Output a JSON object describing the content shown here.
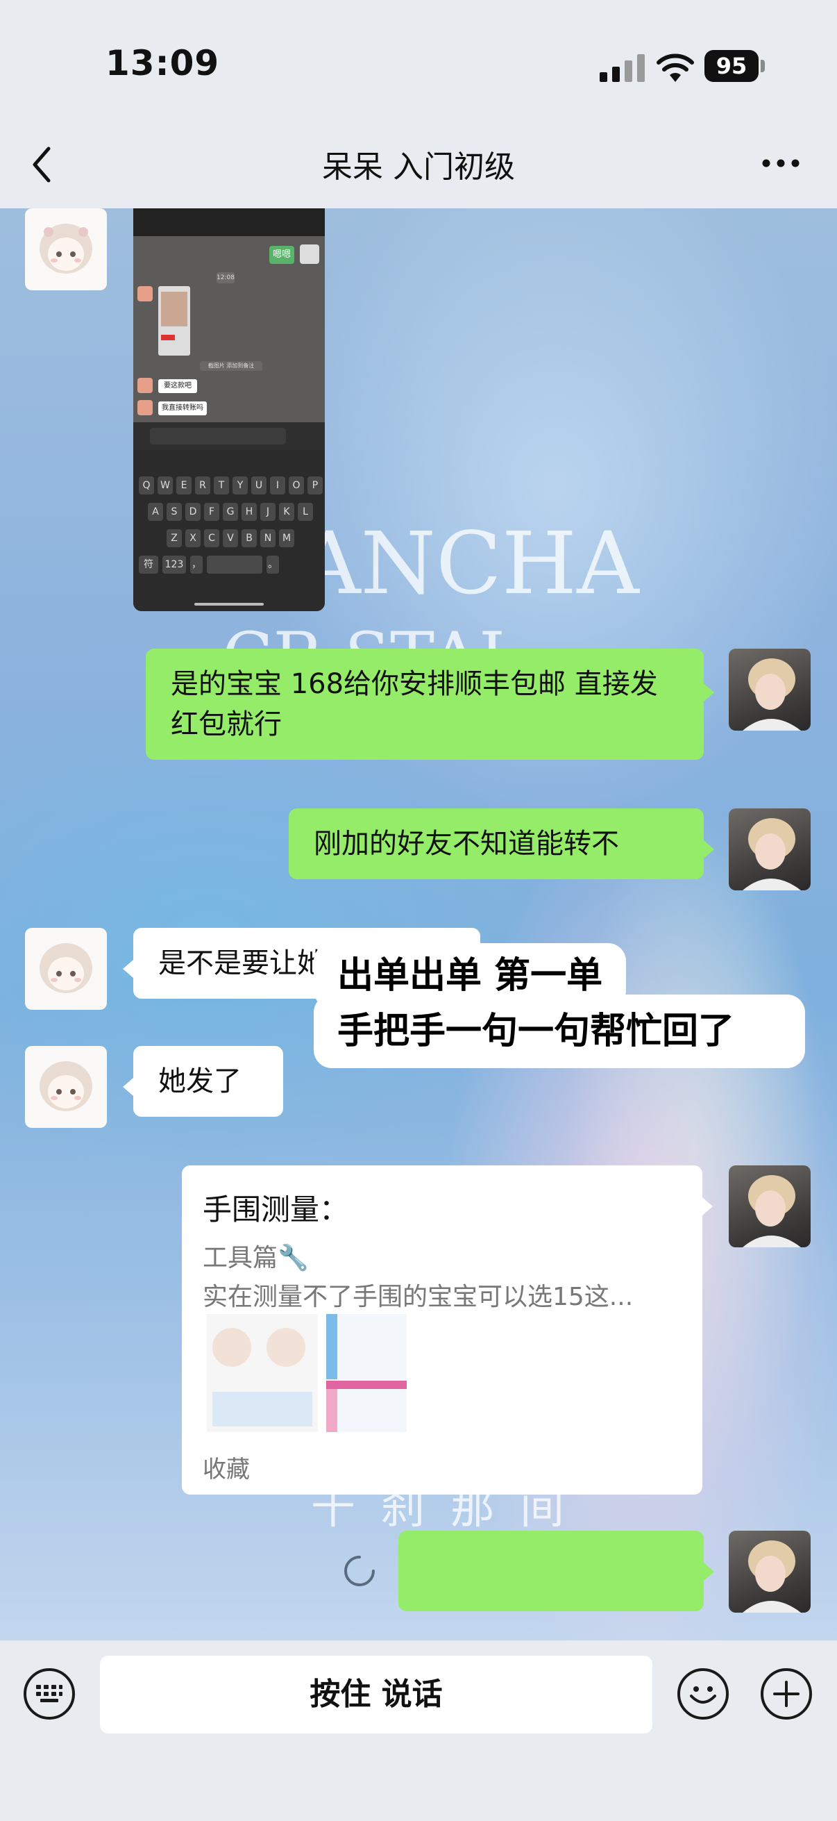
{
  "status": {
    "time": "13:09",
    "battery": "95"
  },
  "header": {
    "title": "呆呆 入门初级"
  },
  "wallpaper": {
    "line1": "ANCHA",
    "line2": "CR STAL",
    "line3": "千 刹 那 间"
  },
  "messages": [
    {
      "from": "other",
      "type": "image",
      "icon": "phone-screenshot"
    },
    {
      "from": "me",
      "type": "text",
      "text": "是的宝宝 168给你安排顺丰包邮 直接发红包就行"
    },
    {
      "from": "me",
      "type": "text",
      "text": "刚加的好友不知道能转不"
    },
    {
      "from": "other",
      "type": "text",
      "text": "是不是要让她给你转钱"
    },
    {
      "from": "other",
      "type": "text",
      "text": "她发了"
    },
    {
      "from": "me",
      "type": "link-card",
      "title": "手围测量：",
      "subtitle": "工具篇🔧",
      "desc": "实在测量不了手围的宝宝可以选15这...",
      "footer": "收藏"
    },
    {
      "from": "me",
      "type": "text",
      "text": "",
      "sending": true
    }
  ],
  "annotation": {
    "line1": "出单出单 第一单",
    "line2": "手把手一句一句帮忙回了"
  },
  "screenshot": {
    "bubble1": "嗯嗯",
    "chip": "12:08",
    "hint": "截图片 添加到备注",
    "msg1": "要这款吧",
    "msg2": "我直接转账吗",
    "row1": [
      "Q",
      "W",
      "E",
      "R",
      "T",
      "Y",
      "U",
      "I",
      "O",
      "P"
    ],
    "row2": [
      "A",
      "S",
      "D",
      "F",
      "G",
      "H",
      "J",
      "K",
      "L"
    ],
    "row3": [
      "Z",
      "X",
      "C",
      "V",
      "B",
      "N",
      "M"
    ],
    "k_fu": "符",
    "k_123": "123",
    "k_comma": "，",
    "k_dot": "。"
  },
  "input": {
    "voice_label": "按住 说话"
  },
  "colors": {
    "green_bubble": "#95ec69",
    "bar": "#e8ecf1"
  }
}
